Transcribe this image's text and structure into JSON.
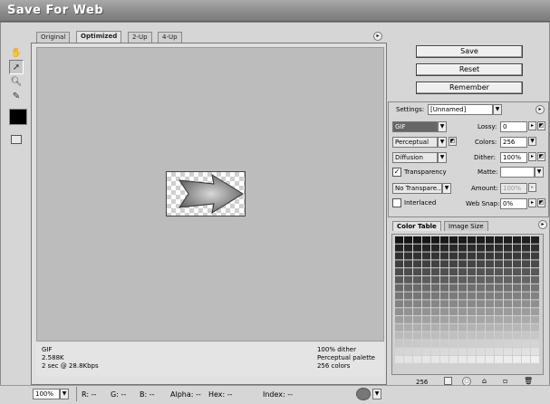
{
  "window": {
    "title": "Save For Web"
  },
  "tabs": [
    {
      "label": "Original"
    },
    {
      "label": "Optimized"
    },
    {
      "label": "2-Up"
    },
    {
      "label": "4-Up"
    }
  ],
  "info": {
    "left_lines": [
      "GIF",
      "2.588K",
      "2 sec @ 28.8Kbps"
    ],
    "right_lines": [
      "100% dither",
      "Perceptual palette",
      "256 colors"
    ]
  },
  "buttons": {
    "save": "Save",
    "reset": "Reset",
    "remember": "Remember"
  },
  "settings": {
    "label": "Settings:",
    "value": "[Unnamed]",
    "format": "GIF",
    "lossy_label": "Lossy:",
    "lossy_value": "0",
    "palette": "Perceptual",
    "colors_label": "Colors:",
    "colors_value": "256",
    "dither_algo": "Diffusion",
    "dither_label": "Dither:",
    "dither_value": "100%",
    "transparency_label": "Transparency",
    "transparency_checked": true,
    "matte_label": "Matte:",
    "matte_value": "",
    "transparency_dither": "No Transpare...",
    "amount_label": "Amount:",
    "amount_value": "100%",
    "interlaced_label": "Interlaced",
    "interlaced_checked": false,
    "websnap_label": "Web Snap:",
    "websnap_value": "0%"
  },
  "color_table": {
    "tabs": [
      "Color Table",
      "Image Size"
    ],
    "count": "256"
  },
  "status": {
    "zoom": "100%",
    "r_label": "R:",
    "r_value": "--",
    "g_label": "G:",
    "g_value": "--",
    "b_label": "B:",
    "b_value": "--",
    "alpha_label": "Alpha:",
    "alpha_value": "--",
    "hex_label": "Hex:",
    "hex_value": "--",
    "index_label": "Index:",
    "index_value": "--"
  },
  "colors": {
    "titlebar": "#8a8a8a",
    "canvas": "#bcbcbc",
    "panel": "#d6d6d6"
  }
}
